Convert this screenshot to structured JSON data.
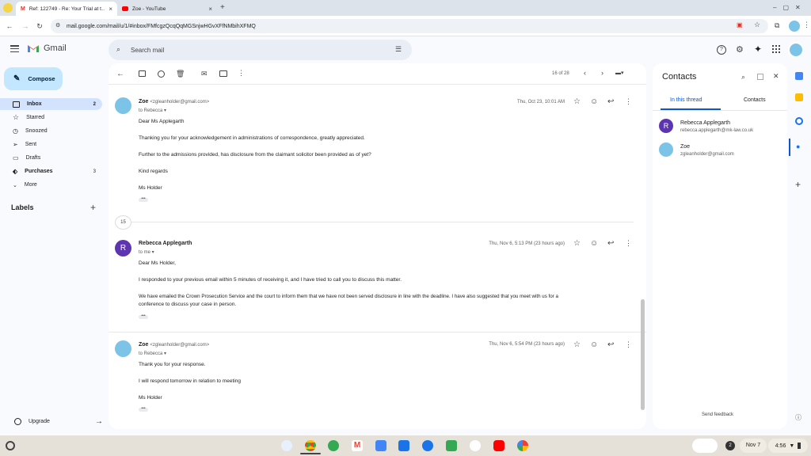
{
  "browser": {
    "tabs": [
      {
        "title": "Ref: 122749 - Re: Your Trial at t…",
        "favicon": "gmail-icon"
      },
      {
        "title": "Zoe - YouTube",
        "favicon": "youtube-icon"
      }
    ],
    "url": "mail.google.com/mail/u/1/#inbox/FMfcgzQcqQqMGSnjwHGvXFfNMbihXFMQ"
  },
  "gmail": {
    "app_name": "Gmail",
    "search_placeholder": "Search mail",
    "compose_label": "Compose",
    "nav": [
      {
        "label": "Inbox",
        "count": "2",
        "icon": "inbox-icon"
      },
      {
        "label": "Starred",
        "count": "",
        "icon": "star-icon"
      },
      {
        "label": "Snoozed",
        "count": "",
        "icon": "clock-icon"
      },
      {
        "label": "Sent",
        "count": "",
        "icon": "send-icon"
      },
      {
        "label": "Drafts",
        "count": "",
        "icon": "draft-icon"
      },
      {
        "label": "Purchases",
        "count": "3",
        "icon": "tag-icon"
      },
      {
        "label": "More",
        "count": "",
        "icon": "chevron-down-icon"
      }
    ],
    "labels_heading": "Labels",
    "upgrade_label": "Upgrade",
    "pagination": "16 of 28",
    "collapsed_count": "15"
  },
  "messages": [
    {
      "sender": "Zoe",
      "email": "<zgleanholder@gmail.com>",
      "to": "to Rebecca",
      "date": "Thu, Oct 23, 10:01 AM",
      "lines": [
        "Dear Ms Applegarth",
        "Thanking you for your acknowledgement in administrations of correspondence, greatly appreciated.",
        "Further to the admissions provided, has disclosure from the claimant solicitor been provided as of yet?",
        "Kind regards",
        "Ms Holder"
      ]
    },
    {
      "sender": "Rebecca Applegarth",
      "email": "",
      "to": "to me",
      "date": "Thu, Nov 6, 5:13 PM (23 hours ago)",
      "lines": [
        "Dear Ms Holder,",
        "I responded to your previous email within 5 minutes of receiving it, and I have tried to call you to discuss this matter.",
        "We have emailed the Crown Prosecution Service and the court to inform them that we have not been served disclosure in line with the deadline. I have also suggested that you meet with us for a",
        "conference to discuss your case in person."
      ]
    },
    {
      "sender": "Zoe",
      "email": "<zgleanholder@gmail.com>",
      "to": "to Rebecca",
      "date": "Thu, Nov 6, 5:54 PM (23 hours ago)",
      "lines": [
        "Thank you for your response.",
        "I will respond tomorrow in relation to meeting",
        "Ms Holder"
      ]
    }
  ],
  "contacts": {
    "title": "Contacts",
    "tabs": [
      "In this thread",
      "Contacts"
    ],
    "people": [
      {
        "initial": "R",
        "name": "Rebecca Applegarth",
        "email": "rebecca.applegarth@mk-law.co.uk"
      },
      {
        "initial": "",
        "name": "Zoe",
        "email": "zgleanholder@gmail.com"
      }
    ],
    "feedback": "Send feedback"
  },
  "shelf": {
    "date": "Nov 7",
    "time": "4:56",
    "notification_count": "2"
  },
  "colors": {
    "accent": "#0b57d0",
    "rebecca_avatar": "#5e35b1",
    "nav_selected": "#d3e3fd",
    "compose": "#c2e7ff"
  }
}
